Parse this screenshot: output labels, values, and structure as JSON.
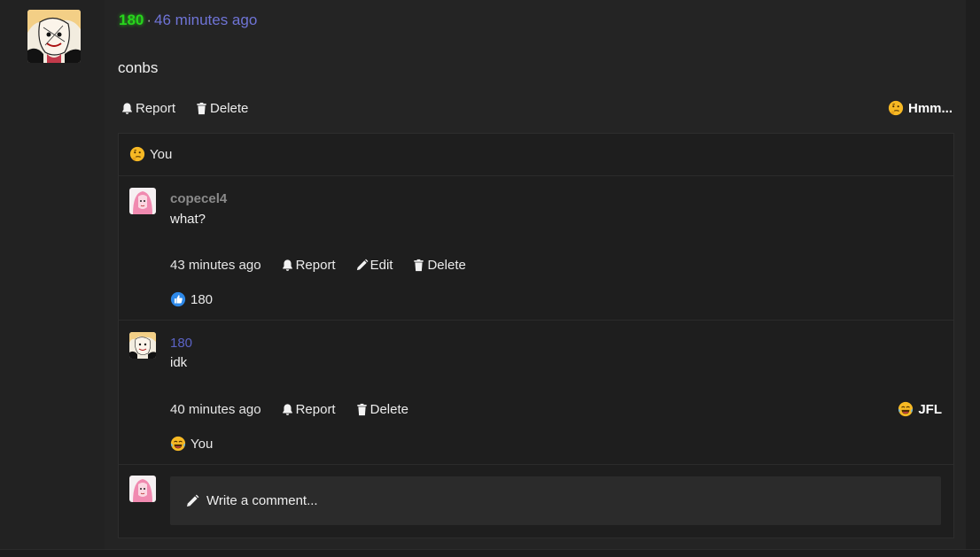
{
  "post": {
    "author": "180",
    "separator": "·",
    "time": "46 minutes ago",
    "body": "conbs",
    "actions": {
      "report": "Report",
      "delete": "Delete"
    },
    "reaction_button": {
      "label": "Hmm...",
      "icon": "thinking-face-emoji"
    },
    "reactions": [
      {
        "icon": "thinking-face-emoji",
        "user": "You"
      }
    ]
  },
  "comments": [
    {
      "author": "copecel4",
      "body": "what?",
      "time": "43 minutes ago",
      "actions": {
        "report": "Report",
        "edit": "Edit",
        "delete": "Delete"
      },
      "reactions": [
        {
          "icon": "thumbs-up-emoji",
          "user": "180"
        }
      ]
    },
    {
      "author": "180",
      "body": "idk",
      "time": "40 minutes ago",
      "actions": {
        "report": "Report",
        "delete": "Delete"
      },
      "reaction_button": {
        "label": "JFL",
        "icon": "tears-of-joy-emoji"
      },
      "reactions": [
        {
          "icon": "tears-of-joy-emoji",
          "user": "You"
        }
      ]
    }
  ],
  "composer": {
    "placeholder": "Write a comment...",
    "icon": "pencil-icon"
  },
  "colors": {
    "author_green": "#27d51c",
    "timestamp_blue": "#6f74d6",
    "username_purple": "#5b63c4",
    "username_gray": "#8a8a8a"
  }
}
